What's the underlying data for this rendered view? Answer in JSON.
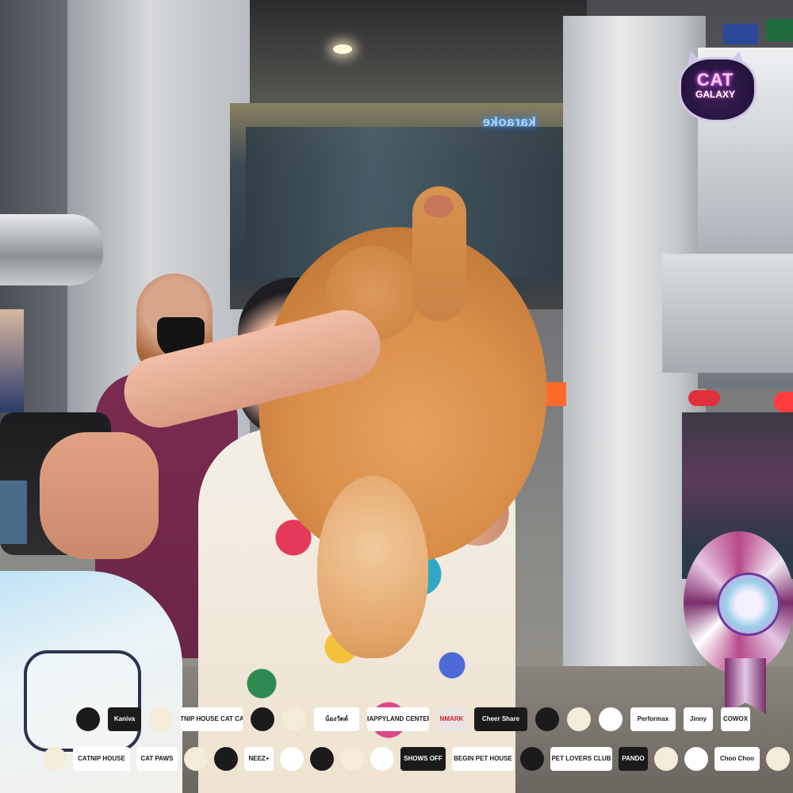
{
  "scene": {
    "event_logo": {
      "line1": "CAT",
      "line2": "GALAXY"
    },
    "background_sign": "karaoke"
  },
  "sponsors": {
    "row1": [
      {
        "text": "",
        "style": "dark",
        "icon": "logo-badge-icon"
      },
      {
        "text": "Kaniva",
        "style": "dark"
      },
      {
        "text": "",
        "style": "cream",
        "icon": "logo-badge-icon"
      },
      {
        "text": "CATNIP HOUSE CAT CAFE",
        "style": "white"
      },
      {
        "text": "",
        "style": "dark",
        "icon": "logo-badge-icon"
      },
      {
        "text": "",
        "style": "cream",
        "icon": "logo-badge-icon"
      },
      {
        "text": "น้องวัตต์",
        "style": "white"
      },
      {
        "text": "HAPPYLAND CENTER",
        "style": "white"
      },
      {
        "text": "NMARK",
        "style": "red"
      },
      {
        "text": "Cheer Share",
        "style": "dark"
      },
      {
        "text": "",
        "style": "dark",
        "icon": "logo-badge-icon"
      },
      {
        "text": "",
        "style": "cream",
        "icon": "logo-badge-icon"
      },
      {
        "text": "",
        "style": "white",
        "icon": "logo-badge-icon"
      },
      {
        "text": "Performax",
        "style": "white"
      },
      {
        "text": "Jinny",
        "style": "white"
      },
      {
        "text": "COWOX",
        "style": "white"
      }
    ],
    "row2": [
      {
        "text": "",
        "style": "cream",
        "icon": "logo-badge-icon"
      },
      {
        "text": "CATNIP HOUSE",
        "style": "white"
      },
      {
        "text": "CAT PAWS",
        "style": "white"
      },
      {
        "text": "",
        "style": "cream",
        "icon": "logo-badge-icon"
      },
      {
        "text": "",
        "style": "dark",
        "icon": "logo-badge-icon"
      },
      {
        "text": "NEEZ+",
        "style": "white"
      },
      {
        "text": "",
        "style": "white",
        "icon": "logo-badge-icon"
      },
      {
        "text": "",
        "style": "dark",
        "icon": "logo-badge-icon"
      },
      {
        "text": "",
        "style": "cream",
        "icon": "logo-badge-icon"
      },
      {
        "text": "",
        "style": "white",
        "icon": "logo-badge-icon"
      },
      {
        "text": "SHOWS OFF",
        "style": "dark"
      },
      {
        "text": "BEGIN PET HOUSE",
        "style": "white"
      },
      {
        "text": "",
        "style": "dark",
        "icon": "logo-badge-icon"
      },
      {
        "text": "PET LOVERS CLUB",
        "style": "white"
      },
      {
        "text": "PANDO",
        "style": "dark"
      },
      {
        "text": "",
        "style": "cream",
        "icon": "logo-badge-icon"
      },
      {
        "text": "",
        "style": "white",
        "icon": "logo-badge-icon"
      },
      {
        "text": "Choo Choo",
        "style": "white"
      },
      {
        "text": "",
        "style": "cream",
        "icon": "logo-badge-icon"
      },
      {
        "text": "",
        "style": "white",
        "icon": "logo-badge-icon"
      }
    ]
  }
}
